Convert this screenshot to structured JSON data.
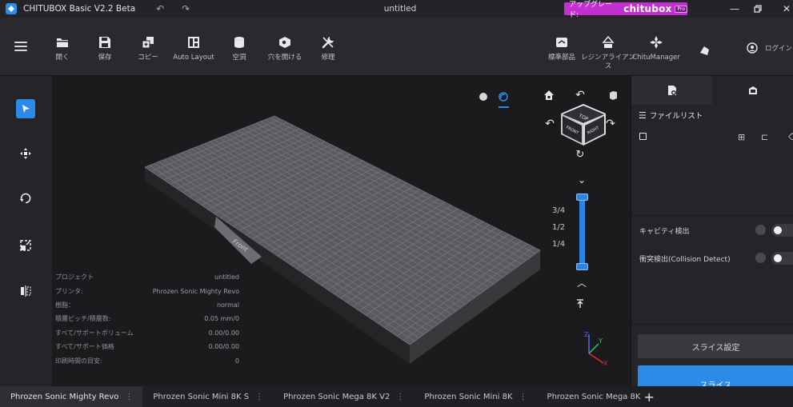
{
  "app": {
    "title": "CHITUBOX Basic V2.2 Beta",
    "window_title": "untitled",
    "upgrade_label": "アップグレード:",
    "upgrade_brand": "chitubox",
    "upgrade_badge": "Pro"
  },
  "toolbar": {
    "tools": [
      {
        "label": "開く",
        "icon": "folder-open-icon"
      },
      {
        "label": "保存",
        "icon": "save-icon"
      },
      {
        "label": "コピー",
        "icon": "copy-icon"
      },
      {
        "label": "Auto Layout",
        "icon": "auto-layout-icon"
      },
      {
        "label": "空洞",
        "icon": "hollow-icon"
      },
      {
        "label": "穴を開ける",
        "icon": "drill-hole-icon"
      },
      {
        "label": "修理",
        "icon": "repair-icon"
      }
    ],
    "right_tools": [
      {
        "label": "標準部品",
        "icon": "standard-parts-icon"
      },
      {
        "label": "レジンアライアン",
        "label2": "ス",
        "icon": "resin-alliance-icon"
      },
      {
        "label": "ChituManager",
        "icon": "chitumanager-icon"
      }
    ],
    "login_label": "ログイン"
  },
  "sidebar": {
    "tools": [
      "select-icon",
      "move-icon",
      "rotate-icon",
      "scale-icon",
      "mirror-icon"
    ]
  },
  "viewport": {
    "plate_label": "Front",
    "cube_faces": {
      "top": "TOP",
      "front": "FRONT",
      "right": "RIGHT"
    },
    "fractions": [
      "3/4",
      "1/2",
      "1/4"
    ],
    "axes": {
      "x": "X",
      "y": "Y",
      "z": "Z"
    },
    "info": [
      {
        "label": "プロジェクト",
        "value": "untitled"
      },
      {
        "label": "プリンタ:",
        "value": "Phrozen Sonic Mighty Revo"
      },
      {
        "label": "樹脂：",
        "value": "normal"
      },
      {
        "label": "積層ピッチ/積層数:",
        "value": "0.05 mm/0"
      },
      {
        "label": "すべて/サポートボリューム",
        "value": "0.00/0.00"
      },
      {
        "label": "すべて/サポート価格",
        "value": "0.00/0.00"
      },
      {
        "label": "印刷時間の目安:",
        "value": "0"
      }
    ]
  },
  "right_panel": {
    "file_list_title": "ファイルリスト",
    "cavity_label": "キャビティ検出",
    "collision_label": "衝突検出(Collision Detect)",
    "slice_settings_label": "スライス設定",
    "slice_label": "スライス"
  },
  "printer_tabs": [
    "Phrozen Sonic Mighty Revo",
    "Phrozen Sonic Mini 8K S",
    "Phrozen Sonic Mega 8K V2",
    "Phrozen Sonic Mini 8K",
    "Phrozen Sonic Mega 8K"
  ],
  "colors": {
    "accent": "#2c8be8",
    "upgrade": "#c42fd2",
    "plate": "#5a5a5e",
    "grid": "#7a7a7e"
  }
}
